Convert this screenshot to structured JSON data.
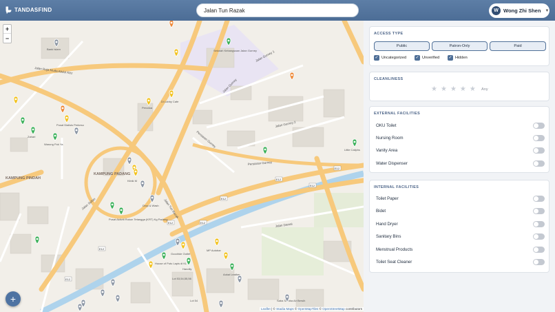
{
  "header": {
    "brand": "TANDASFIND",
    "search_value": "Jalan Tun Razak",
    "user_initial": "W",
    "user_name": "Wong Zhi Shen"
  },
  "map": {
    "zoom_in": "+",
    "zoom_out": "−",
    "add_button": "+",
    "attribution": {
      "leaflet": "Leaflet",
      "sep1": " | © ",
      "stadia": "Stadia Maps",
      "sep2": " © ",
      "omt": "OpenMapTiles",
      "sep3": " © ",
      "osm": "OpenStreetMap",
      "tail": " contributors"
    },
    "labels": {
      "kampung_padang": "KAMPUNG PADANG",
      "kampung_pindah": "KAMPUNG PINDAH",
      "sekolah": "Sekolah Kebangsaan Jalan Gurney",
      "jalan_gurney": "Jalan Gurney",
      "jalan_gurney_1": "Jalan Gurney 1",
      "jalan_gurney_2": "Jalan Gurney 2",
      "persiaran_gurney": "Persiaran Gurney",
      "jalan_tun_razak": "Jalan Tun Razak",
      "jalan_sultan": "Jalan Sultan",
      "jalan_damai": "Jalan Damai",
      "jalan_raja_muda": "Jalan Raja Muda Abdul Aziz",
      "jalan_semarak": "Jalan Semarak",
      "bank_islam": "Bank Islam",
      "perodua": "Perodua",
      "di_lobby_cafe": "Di Lobby Cafe",
      "pusat_dialisis": "Pusat Dialisis Perkeso",
      "zahari": "Zahari",
      "warung": "Warung Pok Ya",
      "little_caliphs": "Little Caliphs",
      "klinik": "Klinik M",
      "drop_wash": "Drop & Wash",
      "pusat_aktiviti": "Pusat Aktiviti Rukun Tetangga (KRT) Kg Padang",
      "goodride": "Goodride Outlet",
      "mp_autobar": "MP Autobar",
      "house_of_putu": "House of Putu Lapis di KL",
      "handily": "Handily",
      "aokai": "Aokai Leather",
      "lot": "Lot 53,54,55,56",
      "lot54": "Lot 54",
      "saba": "Saba Semba Air Bersih"
    },
    "road_markers": [
      "E12",
      "E12",
      "E12",
      "E12",
      "E12",
      "E12",
      "E12",
      "E12"
    ]
  },
  "filters": {
    "access_type": {
      "title": "ACCESS TYPE",
      "options": [
        "Public",
        "Patron-Only",
        "Paid"
      ],
      "checkboxes": [
        {
          "label": "Uncategorized",
          "checked": true
        },
        {
          "label": "Unverified",
          "checked": true
        },
        {
          "label": "Hidden",
          "checked": true
        }
      ]
    },
    "cleanliness": {
      "title": "CLEANLINESS",
      "stars": 5,
      "value_label": "Any"
    },
    "external": {
      "title": "EXTERNAL FACILITIES",
      "items": [
        "OKU Toilet",
        "Nursing Room",
        "Vanity Area",
        "Water Dispenser"
      ]
    },
    "internal": {
      "title": "INTERNAL FACILITIES",
      "items": [
        "Toilet Paper",
        "Bidet",
        "Hand Dryer",
        "Sanitary Bins",
        "Menstrual Products",
        "Toilet Seat Cleaner"
      ]
    }
  },
  "colors": {
    "header": "#4c6d96",
    "accent": "#4f6f97",
    "marker_green": "#3cb15a",
    "marker_yellow": "#f2c21e",
    "marker_orange": "#ee8a3a",
    "marker_grey": "#8d97a5",
    "motorway": "#f7c97c",
    "river": "#aed3ec"
  }
}
